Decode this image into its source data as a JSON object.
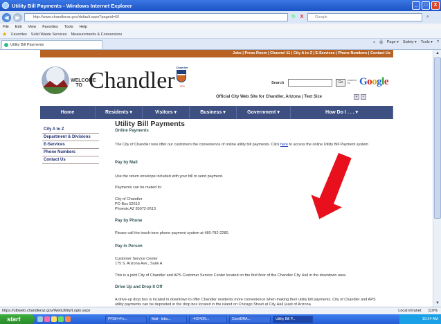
{
  "window": {
    "title": "Utility Bill Payments - Windows Internet Explorer",
    "minimize": "_",
    "maximize": "□",
    "close": "X"
  },
  "address": {
    "url": "http://www.chandleraz.gov/default.aspx?pageid=66",
    "search_placeholder": "Google",
    "go": "→",
    "stop": "X"
  },
  "menu": [
    "File",
    "Edit",
    "View",
    "Favorites",
    "Tools",
    "Help"
  ],
  "favorites": {
    "label": "Favorites",
    "items": [
      "Solid Waste Services",
      "Measurements & Conversions"
    ]
  },
  "tab": {
    "label": "Utility Bill Payments"
  },
  "commands": [
    "Page ▾",
    "Safety ▾",
    "Tools ▾"
  ],
  "site": {
    "toplinks": "Jobs | Press Room | Channel 11 | City A to Z | E-Services | Phone Numbers | Contact Us",
    "welcome": "WELCOME TO",
    "brand": "Chandler",
    "shield_top": "Chandler",
    "shield_bottom": "1920",
    "search_label": "Search",
    "go_label": "Go",
    "powered_by": "powered by",
    "google": "Google",
    "tagline": "Official City Web Site for Chandler, Arizona  |  Text Size",
    "text_size_plus": "+",
    "text_size_minus": "−",
    "nav": [
      {
        "label": "Home",
        "w": 80
      },
      {
        "label": "Residents  ▾",
        "w": 68
      },
      {
        "label": "Visitors  ▾",
        "w": 68
      },
      {
        "label": "Business  ▾",
        "w": 68
      },
      {
        "label": "Government  ▾",
        "w": 78
      },
      {
        "label": "How Do I . . .  ▾",
        "w": 148
      }
    ],
    "sidebar": [
      "City A to Z",
      "Department & Divisions",
      "E-Services",
      "Phone Numbers",
      "Contact Us"
    ],
    "page_title": "Utility Bill Payments",
    "sections": {
      "online": "Online Payments",
      "online_text_a": "The City of Chandler now offer our customers the convenience of online utility bill payments. Click ",
      "online_link": "here",
      "online_text_b": " to access the online Utility Bill Payment system",
      "mail": "Pay by Mail",
      "mail_text": "Use the return envelope included with your bill to send payment.",
      "mail_to": "Payments can be mailed to:",
      "addr1": "City of Chandler",
      "addr2": "PO Box 52613",
      "addr3": "Phoenix AZ 85072-2613",
      "phone": "Pay by Phone",
      "phone_text": "Please call the touch-tone phone payment system at 480-782-2280.",
      "person": "Pay in Person",
      "person_addr1": "Customer Service Center",
      "person_addr2": "175 S. Arizona Ave., Suite A",
      "person_text": "This is a joint City of Chandler and APS Customer Service Center located on the first floor of the Chandler City Hall in the downtown area.",
      "drop": "Drive Up and Drop It Off",
      "drop_text": "A drive-up drop box is located in downtown to offer Chandler residents more convenience when making their utility bill payments. City of Chandler and APS utility payments can be deposited in the drop box located in the island on Chicago Street at City Hall (east of Arizona"
    }
  },
  "status": {
    "url": "https://utbweb.chandleraz.gov/WebUtility/Login.aspx",
    "zone": "Local intranet",
    "zoom": "110%"
  },
  "taskbar": {
    "start": "start",
    "tasks": [
      "PFISH+Fe...",
      "Mail - Inbo...",
      "~4/2/4/20...",
      "CorelDRA...",
      "Utility Bill P..."
    ],
    "clock": "10:24 AM"
  },
  "colors": {
    "toplinks": "#b86224",
    "nav": "#3e4f82",
    "arrow": "#e8101c"
  }
}
